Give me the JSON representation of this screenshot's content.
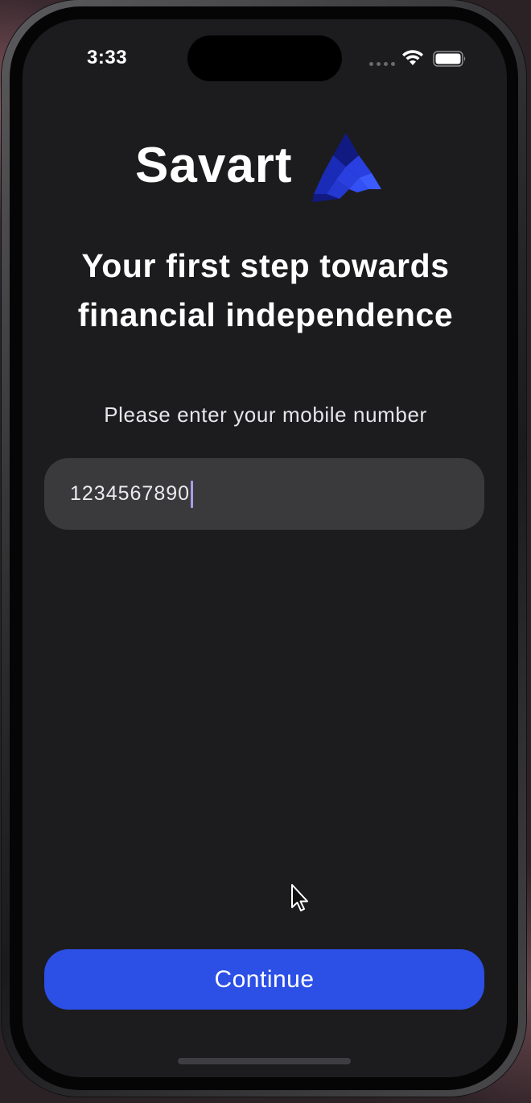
{
  "status_bar": {
    "time": "3:33"
  },
  "brand": {
    "name": "Savart",
    "logo_icon": "savart-logo-icon",
    "logo_colors": [
      "#3b5bff",
      "#2a3fe0",
      "#1a2bb8",
      "#111a80"
    ]
  },
  "headline": {
    "line1": "Your first step towards",
    "line2": "financial independence"
  },
  "prompt": {
    "text": "Please enter your mobile number"
  },
  "phone_input": {
    "value": "1234567890",
    "placeholder": ""
  },
  "continue_button": {
    "label": "Continue",
    "color": "#2c4fe6"
  },
  "colors": {
    "screen_background": "#1c1c1e",
    "input_background": "#3a3a3c",
    "caret": "#a89be8"
  }
}
